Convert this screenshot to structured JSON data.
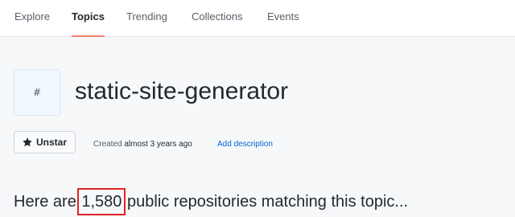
{
  "nav": {
    "tabs": [
      {
        "label": "Explore",
        "selected": false
      },
      {
        "label": "Topics",
        "selected": true
      },
      {
        "label": "Trending",
        "selected": false
      },
      {
        "label": "Collections",
        "selected": false
      },
      {
        "label": "Events",
        "selected": false
      }
    ]
  },
  "topic": {
    "avatar_symbol": "#",
    "title": "static-site-generator"
  },
  "actions": {
    "unstar_label": "Unstar",
    "unstar_icon": "star-icon"
  },
  "meta": {
    "created_prefix": "Created",
    "created_ago": "almost 3 years ago",
    "add_description": "Add description"
  },
  "repos": {
    "prefix": "Here are",
    "count": "1,580",
    "suffix": "public repositories matching this topic..."
  },
  "colors": {
    "selected_tab_underline": "#f9826c",
    "link": "#0366d6",
    "highlight_box": "#e02424"
  }
}
